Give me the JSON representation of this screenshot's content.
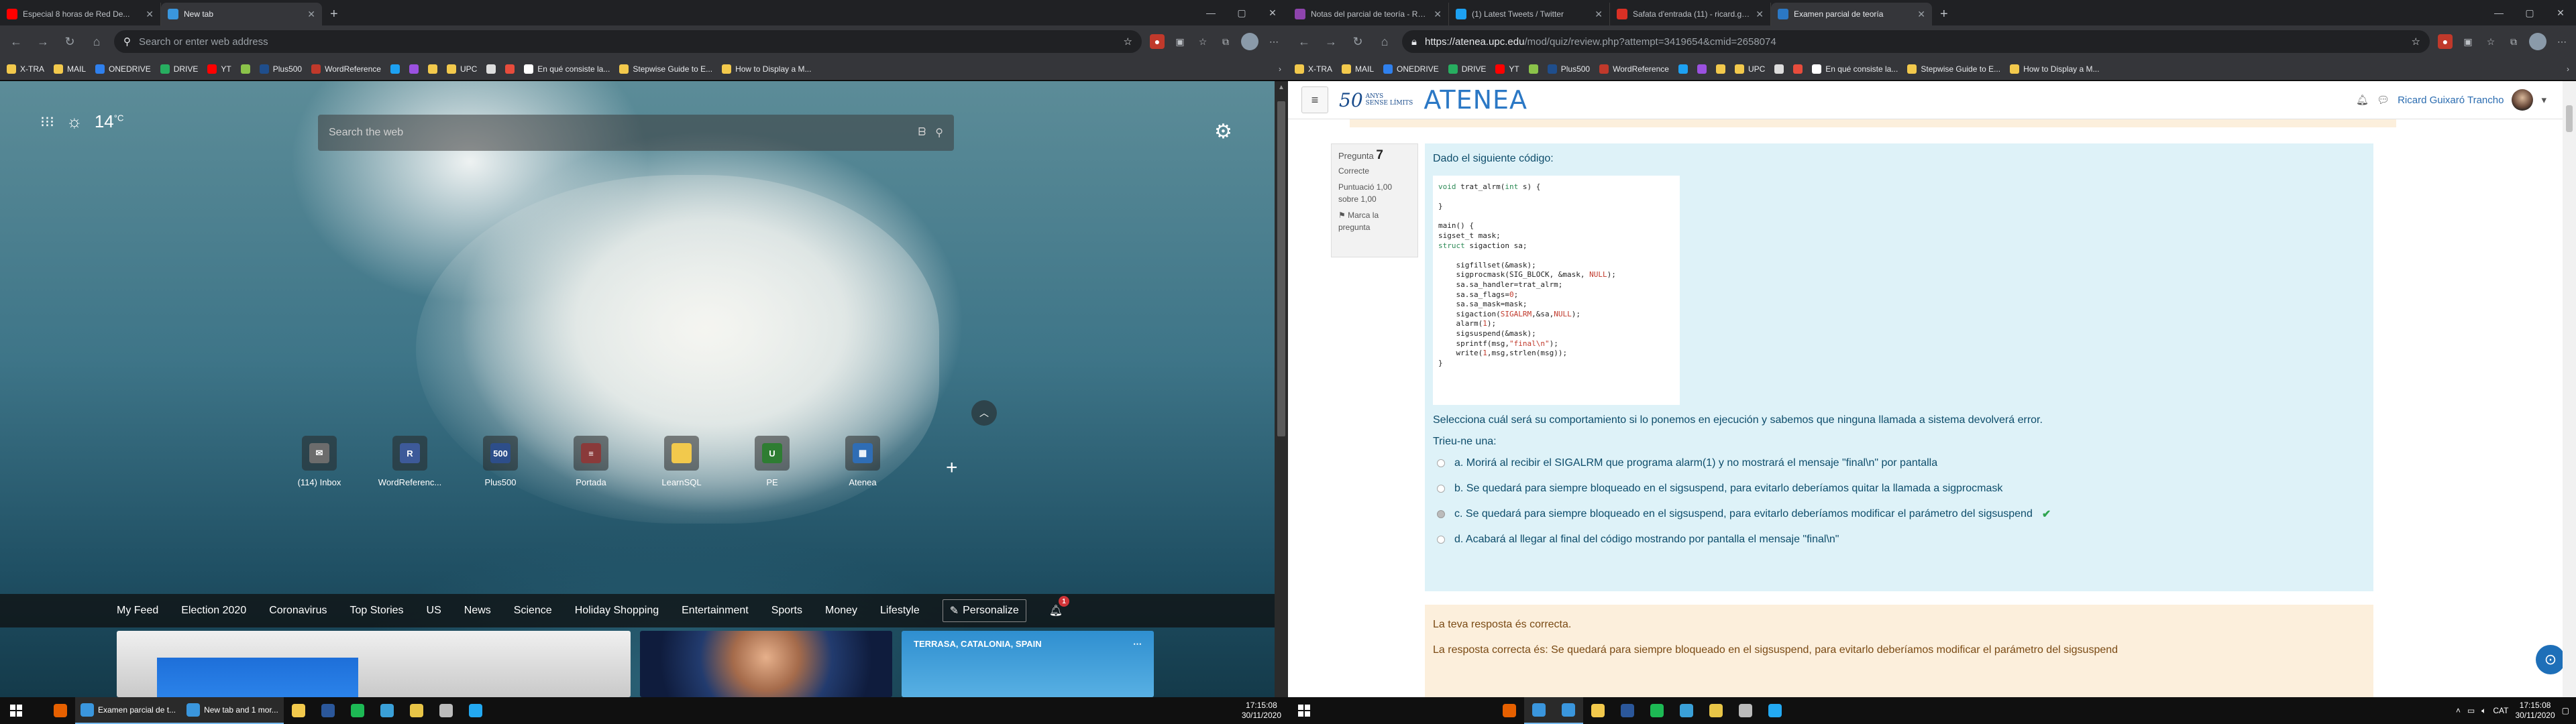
{
  "left": {
    "tabs": [
      {
        "title": "Especial 8 horas de Red De...",
        "icon": "youtube-icon",
        "color": "#ff0000",
        "active": false
      },
      {
        "title": "New tab",
        "icon": "edge-icon",
        "color": "#3a96dd",
        "active": true
      }
    ],
    "address": {
      "placeholder": "Search or enter web address"
    },
    "bookmarks": [
      {
        "label": "X-TRA",
        "color": "#f2c94c"
      },
      {
        "label": "MAIL",
        "color": "#f2c94c"
      },
      {
        "label": "ONEDRIVE",
        "color": "#2f80ed"
      },
      {
        "label": "DRIVE",
        "color": "#27ae60"
      },
      {
        "label": "YT",
        "color": "#ff0000"
      },
      {
        "label": "",
        "color": "#8bc34a"
      },
      {
        "label": "Plus500",
        "color": "#1f4e8c"
      },
      {
        "label": "WordReference",
        "color": "#c0392b"
      },
      {
        "label": "",
        "color": "#1da1f2"
      },
      {
        "label": "",
        "color": "#9b51e0"
      },
      {
        "label": "",
        "color": "#f2c94c"
      },
      {
        "label": "UPC",
        "color": "#f2c94c"
      },
      {
        "label": "",
        "color": "#dddddd"
      },
      {
        "label": "",
        "color": "#e74c3c"
      },
      {
        "label": "En qué consiste la...",
        "color": "#ffffff"
      },
      {
        "label": "Stepwise Guide to E...",
        "color": "#f2c94c"
      },
      {
        "label": "How to Display a M...",
        "color": "#f2c94c"
      }
    ],
    "weather": {
      "temp": "14",
      "unit": "°C"
    },
    "search_placeholder": "Search the web",
    "tiles": [
      {
        "label": "(114) Inbox",
        "color": "#6c6c6c",
        "glyph": "✉"
      },
      {
        "label": "WordReferenc...",
        "color": "#3d5a99",
        "glyph": "R"
      },
      {
        "label": "Plus500",
        "color": "#2d4e8a",
        "glyph": "500"
      },
      {
        "label": "Portada",
        "color": "#8a3a3a",
        "glyph": "≡"
      },
      {
        "label": "LearnSQL",
        "color": "#f2c94c",
        "glyph": ""
      },
      {
        "label": "PE",
        "color": "#2e7d32",
        "glyph": "U"
      },
      {
        "label": "Atenea",
        "color": "#2f6db5",
        "glyph": "▦"
      }
    ],
    "feed_tabs": [
      "My Feed",
      "Election 2020",
      "Coronavirus",
      "Top Stories",
      "US",
      "News",
      "Science",
      "Holiday Shopping",
      "Entertainment",
      "Sports",
      "Money",
      "Lifestyle"
    ],
    "personalize": "Personalize",
    "notif_count": "1",
    "card3_location": "TERRASA, CATALONIA, SPAIN"
  },
  "right": {
    "tabs": [
      {
        "title": "Notas del parcial de teoría - Ra...",
        "icon": "sheets-icon",
        "color": "#8e44ad",
        "active": false
      },
      {
        "title": "(1) Latest Tweets / Twitter",
        "icon": "twitter-icon",
        "color": "#1da1f2",
        "active": false
      },
      {
        "title": "Safata d'entrada (11) - ricard.gu...",
        "icon": "gmail-icon",
        "color": "#d93025",
        "active": false
      },
      {
        "title": "Examen parcial de teoría",
        "icon": "moodle-icon",
        "color": "#2b78c5",
        "active": true
      }
    ],
    "url_host": "https://atenea.upc.edu",
    "url_path": "/mod/quiz/review.php?attempt=3419654&cmid=2658074",
    "logo_num": "50",
    "logo_sub": "ANYS\nSENSE LÍMITS",
    "site": "ATENEA",
    "user": "Ricard Guixaró Trancho",
    "question": {
      "number_prefix": "Pregunta",
      "number": "7",
      "status": "Correcte",
      "score": "Puntuació 1,00 sobre 1,00",
      "flag": "Marca la pregunta",
      "intro": "Dado el siguiente código:",
      "question_text": "Selecciona cuál será su comportamiento si lo ponemos en ejecución y sabemos que ninguna llamada a sistema devolverá error.",
      "choose": "Trieu-ne una:",
      "options": [
        {
          "text": "a. Morirá al recibir el SIGALRM que programa alarm(1) y no mostrará el mensaje \"final\\n\" por pantalla",
          "selected": false
        },
        {
          "text": "b. Se quedará para siempre bloqueado en el sigsuspend, para evitarlo deberíamos quitar la llamada a sigprocmask",
          "selected": false
        },
        {
          "text": "c. Se quedará para siempre bloqueado en el sigsuspend, para evitarlo deberíamos modificar el parámetro del sigsuspend",
          "selected": true
        },
        {
          "text": "d. Acabará al llegar al final del código mostrando por pantalla el mensaje \"final\\n\"",
          "selected": false
        }
      ],
      "feedback_1": "La teva resposta és correcta.",
      "feedback_2": "La resposta correcta és: Se quedará para siempre bloqueado en el sigsuspend, para evitarlo deberíamos modificar el parámetro del sigsuspend"
    }
  },
  "taskbar_left": {
    "apps": [
      {
        "label": "",
        "color": "#e66000",
        "icon": "firefox-icon"
      },
      {
        "label": "Examen parcial de t...",
        "color": "#3a96dd",
        "icon": "edge-icon"
      },
      {
        "label": "New tab and 1 mor...",
        "color": "#3a96dd",
        "icon": "edge-icon"
      },
      {
        "label": "",
        "color": "#f2c94c",
        "icon": "explorer-icon"
      },
      {
        "label": "",
        "color": "#2b579a",
        "icon": "word-icon"
      },
      {
        "label": "",
        "color": "#1db954",
        "icon": "spotify-icon"
      },
      {
        "label": "",
        "color": "#3aa0d8",
        "icon": "photos-icon"
      },
      {
        "label": "",
        "color": "#e8c547",
        "icon": "terminal-icon"
      },
      {
        "label": "",
        "color": "#bbbbbb",
        "icon": "settings-icon"
      },
      {
        "label": "",
        "color": "#23a9f2",
        "icon": "vscode-icon"
      }
    ],
    "time": "17:15:08",
    "date": "30/11/2020"
  },
  "taskbar_right": {
    "lang": "CAT",
    "time": "17:15:08",
    "date": "30/11/2020"
  }
}
